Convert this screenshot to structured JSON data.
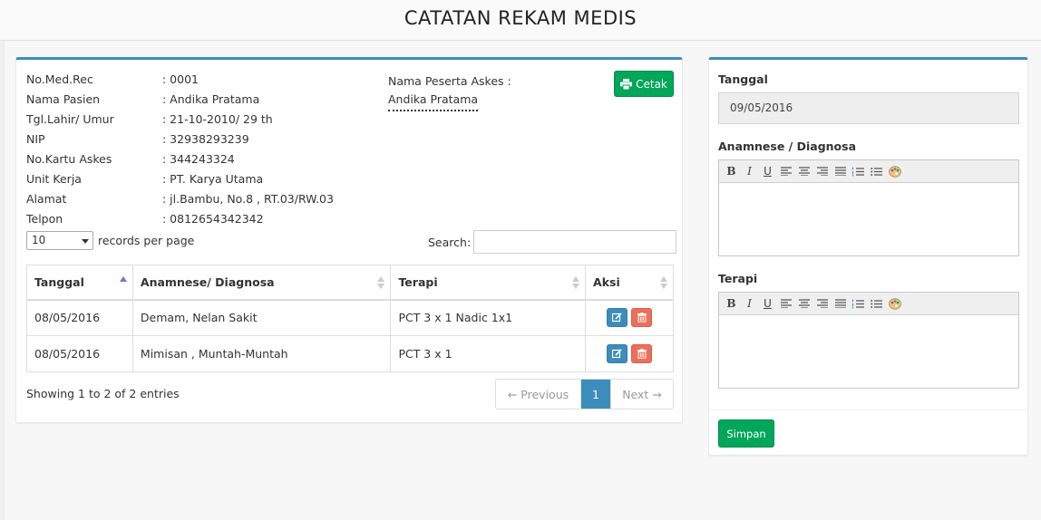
{
  "page": {
    "title": "CATATAN REKAM MEDIS"
  },
  "patient": {
    "rows": [
      {
        "label": "No.Med.Rec",
        "value": ": 0001"
      },
      {
        "label": "Nama Pasien",
        "value": ": Andika Pratama"
      },
      {
        "label": "Tgl.Lahir/ Umur",
        "value": ": 21-10-2010/ 29 th"
      },
      {
        "label": "NIP",
        "value": ": 32938293239"
      },
      {
        "label": "No.Kartu Askes",
        "value": ": 344243324"
      },
      {
        "label": "Unit Kerja",
        "value": ": PT. Karya Utama"
      },
      {
        "label": "Alamat",
        "value": ": jl.Bambu, No.8 , RT.03/RW.03"
      },
      {
        "label": "Telpon",
        "value": ": 0812654342342"
      }
    ],
    "askes_label": "Nama Peserta Askes :",
    "askes_name": "Andika Pratama"
  },
  "print_button": {
    "label": "Cetak",
    "icon": "print-icon"
  },
  "table_controls": {
    "page_length": "10",
    "records_per_page": "records per page",
    "search_label": "Search:",
    "search_value": ""
  },
  "table": {
    "headers": [
      "Tanggal",
      "Anamnese/ Diagnosa",
      "Terapi",
      "Aksi"
    ],
    "rows": [
      {
        "tanggal": "08/05/2016",
        "diagnosa": "Demam, Nelan Sakit",
        "terapi": "PCT 3 x 1 Nadic 1x1"
      },
      {
        "tanggal": "08/05/2016",
        "diagnosa": "Mimisan , Muntah-Muntah",
        "terapi": "PCT 3 x 1"
      }
    ]
  },
  "footer": {
    "showing": "Showing 1 to 2 of 2 entries",
    "prev": "← Previous",
    "page": "1",
    "next": "Next →"
  },
  "form": {
    "tanggal_label": "Tanggal",
    "tanggal_value": "09/05/2016",
    "diagnosa_label": "Anamnese / Diagnosa",
    "terapi_label": "Terapi",
    "save_label": "Simpan"
  },
  "colors": {
    "primary": "#3c8dbc",
    "success": "#00a65a",
    "danger": "#e9573f"
  }
}
